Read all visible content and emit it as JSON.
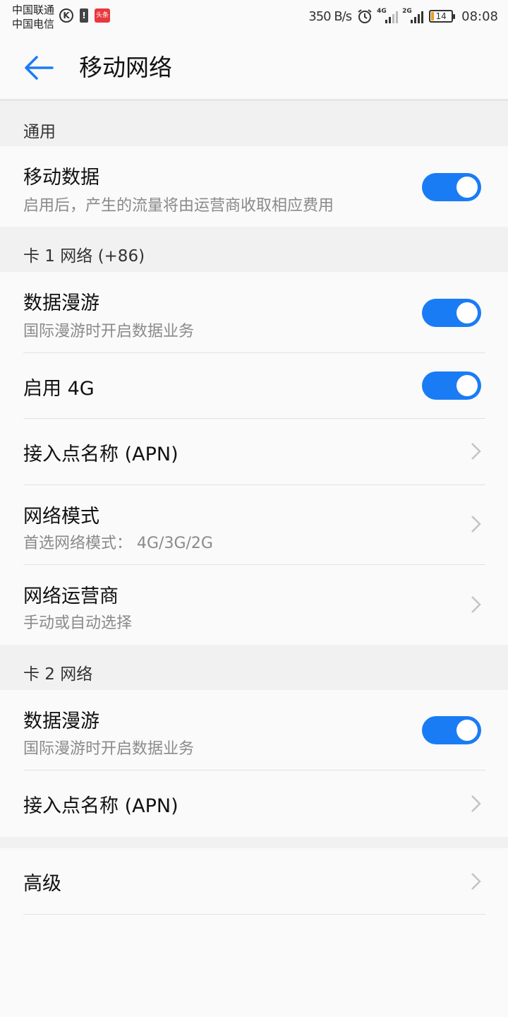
{
  "status_bar": {
    "carrier_1": "中国联通",
    "carrier_2": "中国电信",
    "k_icon_label": "K",
    "alert_icon_label": "!",
    "news_icon_label": "头条",
    "net_speed": "350 B/s",
    "sim1_tag": "4G",
    "sim2_tag": "2G",
    "battery_level": "14",
    "battery_fill_percent": 14,
    "time": "08:08",
    "accent_battery": "#f39a1c"
  },
  "app_bar": {
    "title": "移动网络",
    "back_icon": "arrow-left-icon",
    "accent": "#1a7cf5"
  },
  "sections": {
    "general": {
      "header": "通用",
      "mobile_data": {
        "title": "移动数据",
        "subtitle": "启用后，产生的流量将由运营商收取相应费用",
        "enabled": true
      }
    },
    "sim1": {
      "header": "卡 1 网络 (+86)",
      "data_roaming": {
        "title": "数据漫游",
        "subtitle": "国际漫游时开启数据业务",
        "enabled": true
      },
      "enable_4g": {
        "title": "启用 4G",
        "enabled": true
      },
      "apn": {
        "title": "接入点名称 (APN)"
      },
      "network_mode": {
        "title": "网络模式",
        "subtitle": "首选网络模式： 4G/3G/2G"
      },
      "network_operator": {
        "title": "网络运营商",
        "subtitle": "手动或自动选择"
      }
    },
    "sim2": {
      "header": "卡 2 网络",
      "data_roaming": {
        "title": "数据漫游",
        "subtitle": "国际漫游时开启数据业务",
        "enabled": true
      },
      "apn": {
        "title": "接入点名称 (APN)"
      }
    },
    "advanced": {
      "title": "高级"
    }
  },
  "colors": {
    "toggle_on": "#1a7cf5",
    "section_header_bg": "#f1f1f1",
    "subtitle_text": "#8a8a8a"
  }
}
